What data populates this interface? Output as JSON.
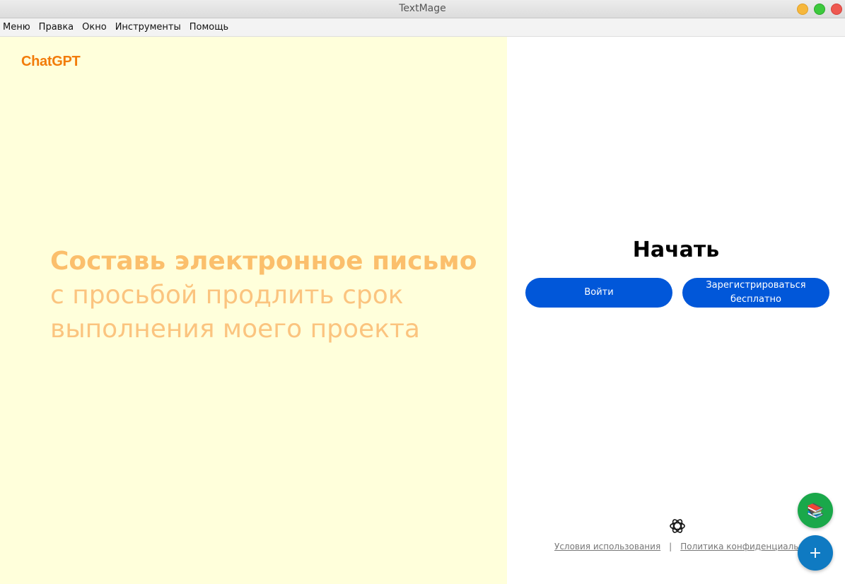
{
  "window": {
    "title": "TextMage"
  },
  "menubar": {
    "items": [
      "Меню",
      "Правка",
      "Окно",
      "Инструменты",
      "Помощь"
    ]
  },
  "left": {
    "brand": "ChatGPT",
    "headline_strong": "Составь электронное письмо",
    "headline_line2": "с просьбой продлить срок",
    "headline_line3": "выполнения моего проекта"
  },
  "right": {
    "title": "Начать",
    "login_label": "Войти",
    "signup_label": "Зарегистрироваться бесплатно",
    "terms_link": "Условия использования",
    "separator": "|",
    "privacy_link": "Политика конфиденциальности"
  },
  "fabs": {
    "books_icon": "📚",
    "plus_icon": "+"
  },
  "colors": {
    "left_bg": "#ffffdb",
    "brand": "#f27c0a",
    "headline": "#fbc47f",
    "button": "#0157d9",
    "fab_green": "#1aa84a",
    "fab_blue": "#0f7ac2"
  },
  "icons": {
    "logo": "openai-logo-icon",
    "books": "books-icon",
    "plus": "plus-icon"
  }
}
